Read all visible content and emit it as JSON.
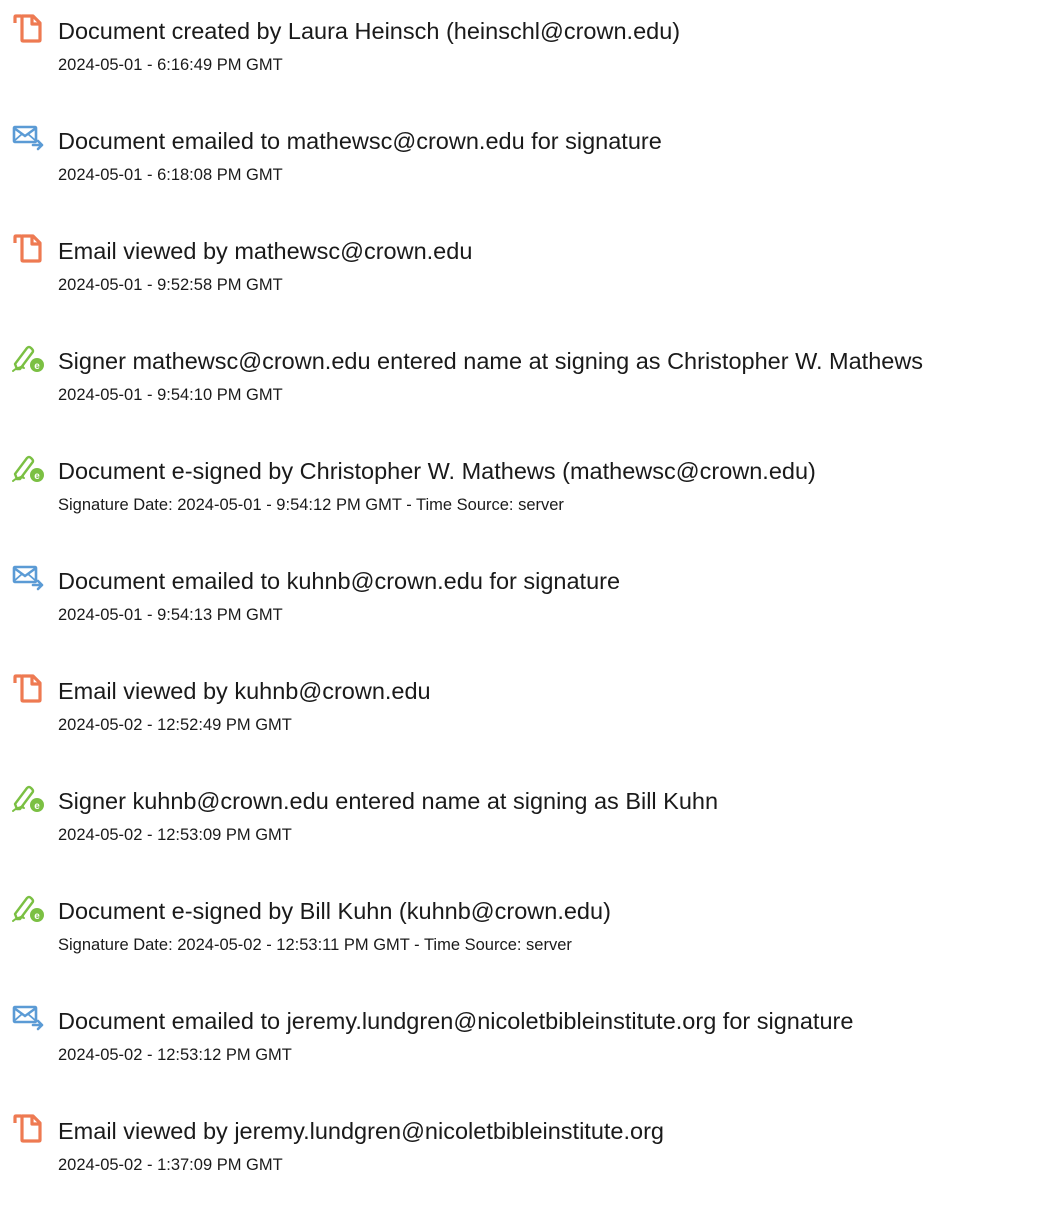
{
  "events": [
    {
      "icon": "document-icon",
      "title": "Document created by Laura Heinsch (heinschl@crown.edu)",
      "stamp": "2024-05-01 - 6:16:49 PM GMT"
    },
    {
      "icon": "email-sent-icon",
      "title": "Document emailed to mathewsc@crown.edu for signature",
      "stamp": "2024-05-01 - 6:18:08 PM GMT"
    },
    {
      "icon": "document-icon",
      "title": "Email viewed by mathewsc@crown.edu",
      "stamp": "2024-05-01 - 9:52:58 PM GMT"
    },
    {
      "icon": "pen-sign-icon",
      "title": "Signer mathewsc@crown.edu entered name at signing as Christopher W. Mathews",
      "stamp": "2024-05-01 - 9:54:10 PM GMT"
    },
    {
      "icon": "pen-sign-icon",
      "title": "Document e-signed by Christopher W. Mathews (mathewsc@crown.edu)",
      "stamp": "Signature Date: 2024-05-01 - 9:54:12 PM GMT - Time Source: server"
    },
    {
      "icon": "email-sent-icon",
      "title": "Document emailed to kuhnb@crown.edu for signature",
      "stamp": "2024-05-01 - 9:54:13 PM GMT"
    },
    {
      "icon": "document-icon",
      "title": "Email viewed by kuhnb@crown.edu",
      "stamp": "2024-05-02 - 12:52:49 PM GMT"
    },
    {
      "icon": "pen-sign-icon",
      "title": "Signer kuhnb@crown.edu entered name at signing as Bill Kuhn",
      "stamp": "2024-05-02 - 12:53:09 PM GMT"
    },
    {
      "icon": "pen-sign-icon",
      "title": "Document e-signed by Bill Kuhn (kuhnb@crown.edu)",
      "stamp": "Signature Date: 2024-05-02 - 12:53:11 PM GMT - Time Source: server"
    },
    {
      "icon": "email-sent-icon",
      "title": "Document emailed to jeremy.lundgren@nicoletbibleinstitute.org for signature",
      "stamp": "2024-05-02 - 12:53:12 PM GMT"
    },
    {
      "icon": "document-icon",
      "title": "Email viewed by jeremy.lundgren@nicoletbibleinstitute.org",
      "stamp": "2024-05-02 - 1:37:09 PM GMT"
    }
  ],
  "colors": {
    "document_icon": "#ee7a52",
    "email_icon": "#5b9bd5",
    "pen_icon": "#7bc043",
    "text": "#1a1a1a"
  }
}
